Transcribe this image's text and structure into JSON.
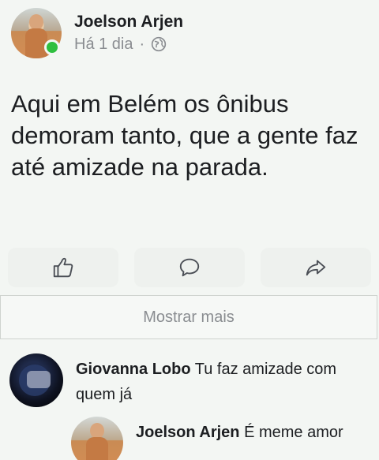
{
  "post": {
    "author": "Joelson Arjen",
    "time": "Há 1 dia",
    "separator": "·",
    "privacy_icon": "globe-icon",
    "text": "Aqui em Belém os ônibus demoram tanto, que a gente faz até amizade na parada."
  },
  "actions": [
    {
      "icon": "like-icon"
    },
    {
      "icon": "comment-icon"
    },
    {
      "icon": "share-icon"
    }
  ],
  "show_more": "Mostrar mais",
  "comments": [
    {
      "author": "Giovanna Lobo",
      "text": "Tu faz amizade com quem já"
    },
    {
      "author": "Joelson Arjen",
      "text": "É meme amor"
    }
  ],
  "colors": {
    "online": "#2fbf3f",
    "muted_text": "#8a8d91",
    "icon": "#4b4f56"
  }
}
